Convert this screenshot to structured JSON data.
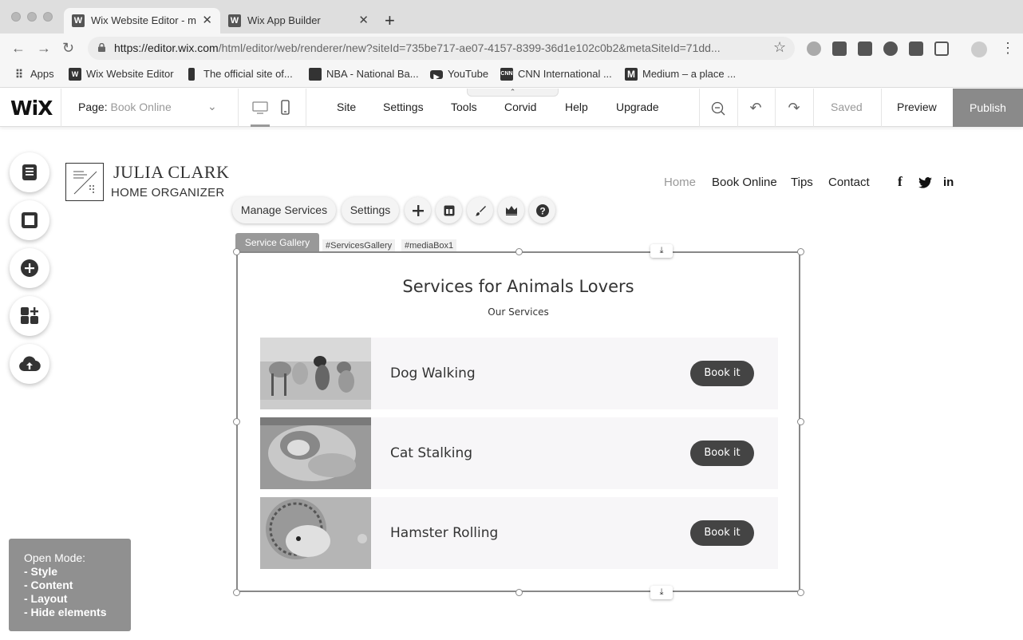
{
  "browser": {
    "tabs": [
      {
        "label": "Wix Website Editor - m",
        "active": true
      },
      {
        "label": "Wix App Builder",
        "active": false
      }
    ],
    "url_host": "https://editor.wix.com",
    "url_path": "/html/editor/web/renderer/new?siteId=735be717-ae07-4157-8399-36d1e102c0b2&metaSiteId=71dd...",
    "bookmarks": [
      {
        "label": "Apps",
        "icon": "apps-grid-icon"
      },
      {
        "label": "Wix Website Editor",
        "icon": "wix-favicon"
      },
      {
        "label": "The official site of...",
        "icon": "nba-logo-icon"
      },
      {
        "label": "NBA - National Ba...",
        "icon": "nba-logo-icon"
      },
      {
        "label": "YouTube",
        "icon": "youtube-icon"
      },
      {
        "label": "CNN International ...",
        "icon": "cnn-icon"
      },
      {
        "label": "Medium – a place ...",
        "icon": "medium-icon"
      }
    ]
  },
  "editor": {
    "logo": "WiX",
    "page_label": "Page:",
    "page_value": "Book Online",
    "menu": [
      "Site",
      "Settings",
      "Tools",
      "Corvid",
      "Help",
      "Upgrade"
    ],
    "saved_label": "Saved",
    "preview_label": "Preview",
    "publish_label": "Publish"
  },
  "site": {
    "name": "JULIA CLARK",
    "subtitle": "HOME ORGANIZER",
    "nav": [
      "Home",
      "Book Online",
      "Tips",
      "Contact"
    ],
    "social": [
      "f",
      "twitter",
      "in"
    ]
  },
  "gfpp": {
    "manage_label": "Manage Services",
    "settings_label": "Settings"
  },
  "selection": {
    "tag": "Service Gallery",
    "ids": [
      "#ServicesGallery",
      "#mediaBox1"
    ]
  },
  "gallery": {
    "title": "Services for Animals Lovers",
    "subtitle": "Our Services",
    "services": [
      {
        "name": "Dog Walking",
        "button": "Book it"
      },
      {
        "name": "Cat Stalking",
        "button": "Book it"
      },
      {
        "name": "Hamster Rolling",
        "button": "Book it"
      }
    ]
  },
  "open_mode": {
    "title": "Open Mode:",
    "items": [
      "- Style",
      "- Content",
      "- Layout",
      "- Hide elements"
    ]
  }
}
